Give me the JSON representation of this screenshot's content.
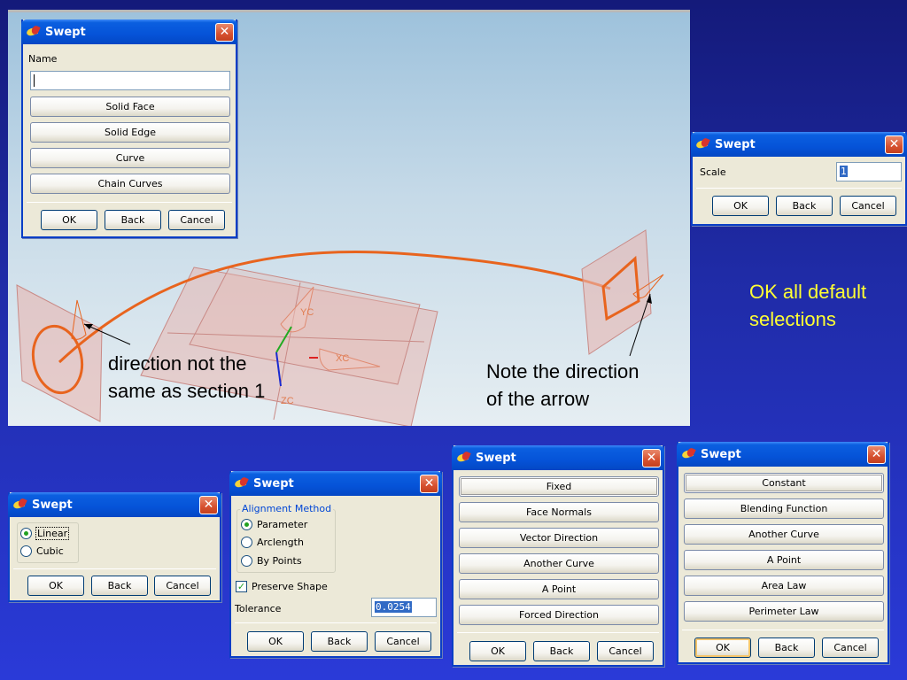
{
  "viewport_annotations": {
    "left_note": "direction not the\nsame as section 1",
    "right_note": "Note the direction\nof the arrow",
    "axis_yc": "YC",
    "axis_xc": "XC",
    "axis_zc": "ZC"
  },
  "side_note": "OK all default\nselections",
  "dialog_title": "Swept",
  "dialog_name": {
    "label": "Name",
    "value": "",
    "buttons": [
      "Solid Face",
      "Solid Edge",
      "Curve",
      "Chain Curves"
    ],
    "ok": "OK",
    "back": "Back",
    "cancel": "Cancel"
  },
  "dialog_scale": {
    "label": "Scale",
    "value": "1",
    "ok": "OK",
    "back": "Back",
    "cancel": "Cancel"
  },
  "dialog_interp": {
    "options": [
      "Linear",
      "Cubic"
    ],
    "selected": "Linear",
    "ok": "OK",
    "back": "Back",
    "cancel": "Cancel"
  },
  "dialog_alignment": {
    "group_label": "Alignment Method",
    "options": [
      "Parameter",
      "Arclength",
      "By Points"
    ],
    "selected": "Parameter",
    "preserve_label": "Preserve Shape",
    "preserve_checked": true,
    "tolerance_label": "Tolerance",
    "tolerance_value": "0.0254",
    "ok": "OK",
    "back": "Back",
    "cancel": "Cancel"
  },
  "dialog_orientation": {
    "buttons": [
      "Fixed",
      "Face Normals",
      "Vector Direction",
      "Another Curve",
      "A Point",
      "Forced Direction"
    ],
    "ok": "OK",
    "back": "Back",
    "cancel": "Cancel"
  },
  "dialog_scaling": {
    "buttons": [
      "Constant",
      "Blending Function",
      "Another Curve",
      "A Point",
      "Area Law",
      "Perimeter Law"
    ],
    "ok": "OK",
    "back": "Back",
    "cancel": "Cancel"
  },
  "colors": {
    "curve": "#e8641e",
    "plane": "#e8b6b0",
    "slide_bg": "#1f2ba6",
    "note_yellow": "#ffff33"
  }
}
